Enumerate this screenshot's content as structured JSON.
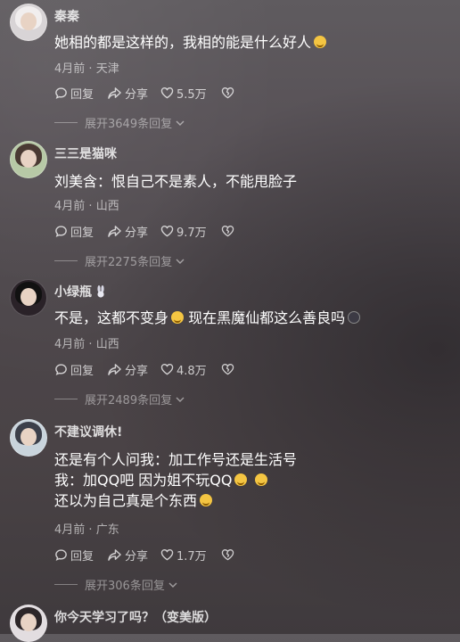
{
  "comments": [
    {
      "username": "秦秦",
      "lines": [
        "她相的都是这样的，我相的能是什么好人"
      ],
      "emoji": "thinking-emoji",
      "date": "4月前",
      "location": "天津",
      "reply_label": "回复",
      "share_label": "分享",
      "likes": "5.5万",
      "expand_label": "展开3649条回复"
    },
    {
      "username": "三三是猫咪",
      "lines": [
        "刘美含：恨自己不是素人，不能甩脸子"
      ],
      "date": "4月前",
      "location": "山西",
      "reply_label": "回复",
      "share_label": "分享",
      "likes": "9.7万",
      "expand_label": "展开2275条回复"
    },
    {
      "username": "小绿瓶",
      "lines": [
        "不是，这都不变身",
        "现在黑魔仙都这么善良吗"
      ],
      "date": "4月前",
      "location": "山西",
      "reply_label": "回复",
      "share_label": "分享",
      "likes": "4.8万",
      "expand_label": "展开2489条回复"
    },
    {
      "username": "不建议调休!",
      "lines": [
        "还是有个人问我：加工作号还是生活号",
        "我：加QQ吧  因为姐不玩QQ",
        "还以为自己真是个东西"
      ],
      "date": "4月前",
      "location": "广东",
      "reply_label": "回复",
      "share_label": "分享",
      "likes": "1.7万",
      "expand_label": "展开306条回复"
    },
    {
      "username": "你今天学习了吗？（变美版）"
    }
  ],
  "meta_separator": " · ",
  "icons": {
    "reply": "reply-icon",
    "share": "share-icon",
    "like": "heart-icon",
    "dislike": "broken-heart-icon",
    "expand": "chevron-down-icon"
  }
}
